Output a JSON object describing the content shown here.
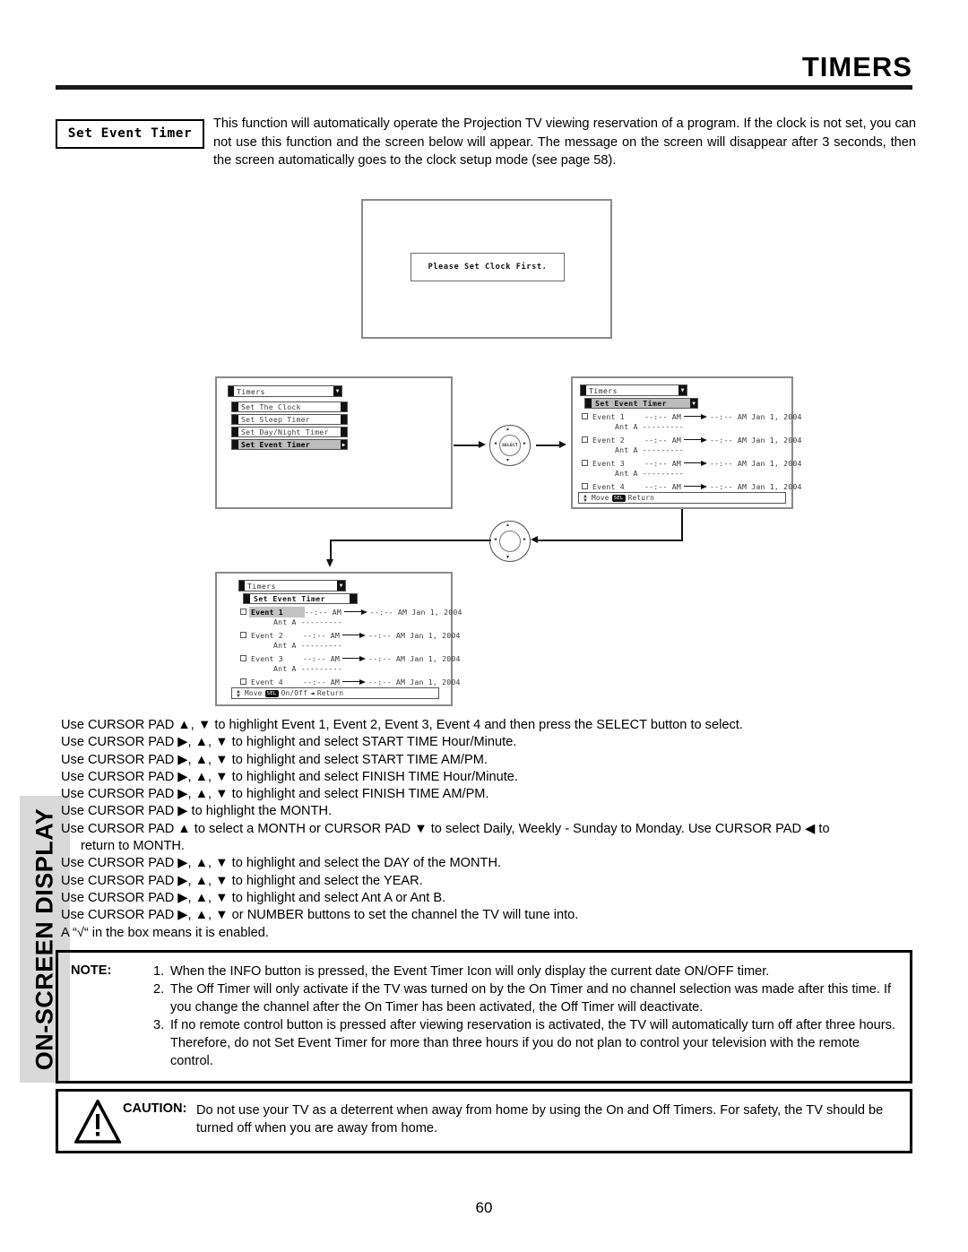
{
  "page": {
    "title": "TIMERS",
    "number": "60",
    "section_tab": "ON-SCREEN DISPLAY"
  },
  "intro": {
    "badge": "Set Event Timer",
    "text": "This function will automatically operate the Projection TV viewing reservation of a program.  If the clock is not set, you can not use this function and the screen below will appear.  The message on the screen will disappear after 3 seconds, then the screen automatically goes to the clock setup mode (see page 58)."
  },
  "screens": {
    "clock_warning": {
      "message": "Please Set Clock First."
    },
    "timers_menu": {
      "title": "Timers",
      "title_arrow": "▼",
      "items": [
        {
          "label": "Set The Clock",
          "selected": false,
          "right_glyph": ""
        },
        {
          "label": "Set Sleep Timer",
          "selected": false,
          "right_glyph": ""
        },
        {
          "label": "Set Day/Night Timer",
          "selected": false,
          "right_glyph": ""
        },
        {
          "label": "Set Event Timer",
          "selected": true,
          "right_glyph": "▶"
        }
      ]
    },
    "event_timer_right": {
      "title": "Timers",
      "title_arrow": "▼",
      "subtitle": "Set Event Timer",
      "subtitle_arrow": "▼",
      "highlight_row": -1,
      "rows": [
        {
          "name": "Event 1",
          "start": "--:-- AM",
          "finish": "--:-- AM",
          "date": "Jan 1, 2004",
          "ant": "Ant A ---------"
        },
        {
          "name": "Event 2",
          "start": "--:-- AM",
          "finish": "--:-- AM",
          "date": "Jan 1, 2004",
          "ant": "Ant A ---------"
        },
        {
          "name": "Event 3",
          "start": "--:-- AM",
          "finish": "--:-- AM",
          "date": "Jan 1, 2004",
          "ant": "Ant A ---------"
        },
        {
          "name": "Event 4",
          "start": "--:-- AM",
          "finish": "--:-- AM",
          "date": "Jan 1, 2004",
          "ant": "Ant A ---------"
        }
      ],
      "footer": {
        "move": "Move",
        "sel_key": "SEL",
        "action": "",
        "return": "Return"
      }
    },
    "event_timer_bottom": {
      "title": "Timers",
      "title_arrow": "▼",
      "subtitle": "Set Event Timer",
      "subtitle_arrow": "",
      "highlight_row": 0,
      "rows": [
        {
          "name": "Event 1",
          "start": "--:-- AM",
          "finish": "--:-- AM",
          "date": "Jan 1, 2004",
          "ant": "Ant A ---------"
        },
        {
          "name": "Event 2",
          "start": "--:-- AM",
          "finish": "--:-- AM",
          "date": "Jan 1, 2004",
          "ant": "Ant A ---------"
        },
        {
          "name": "Event 3",
          "start": "--:-- AM",
          "finish": "--:-- AM",
          "date": "Jan 1, 2004",
          "ant": "Ant A ---------"
        },
        {
          "name": "Event 4",
          "start": "--:-- AM",
          "finish": "--:-- AM",
          "date": "Jan 1, 2004",
          "ant": "Ant A ---------"
        }
      ],
      "footer": {
        "move": "Move",
        "sel_key": "SEL",
        "action": "On/Off",
        "return": "Return"
      }
    }
  },
  "cursor_pads": {
    "top": {
      "hub_label": "SELECT"
    },
    "bottom": {
      "hub_label": ""
    }
  },
  "instructions": [
    "Use CURSOR PAD ▲, ▼ to highlight Event 1, Event 2, Event 3, Event 4 and then press the SELECT button to select.",
    "Use CURSOR PAD ▶, ▲, ▼ to highlight and select START TIME Hour/Minute.",
    "Use CURSOR PAD ▶, ▲, ▼ to highlight and select START TIME AM/PM.",
    "Use CURSOR PAD ▶, ▲, ▼ to highlight and select FINISH TIME Hour/Minute.",
    "Use CURSOR PAD ▶, ▲, ▼ to highlight and select FINISH TIME AM/PM.",
    "Use CURSOR PAD ▶ to highlight the MONTH.",
    "Use CURSOR PAD ▲ to select a MONTH or CURSOR PAD ▼ to select Daily, Weekly - Sunday to Monday.  Use CURSOR PAD ◀ to",
    "return to MONTH.",
    "Use CURSOR PAD ▶, ▲, ▼ to highlight and select the DAY of the MONTH.",
    "Use CURSOR PAD ▶, ▲, ▼ to highlight and select the YEAR.",
    "Use CURSOR PAD ▶, ▲, ▼ to highlight and select Ant A or Ant B.",
    "Use CURSOR PAD ▶, ▲, ▼ or NUMBER buttons to set the channel the TV will tune into.",
    "A “√“ in the box means it is enabled."
  ],
  "note": {
    "label": "NOTE:",
    "items": [
      {
        "num": "1.",
        "text": "When the INFO button is pressed, the Event Timer Icon will only display the current date ON/OFF timer."
      },
      {
        "num": "2.",
        "text": "The Off Timer will only activate if the TV was turned on by the On Timer and no channel selection was made after this time.  If you change the channel after the On Timer has been activated, the Off Timer will deactivate."
      },
      {
        "num": "3.",
        "text": "If no remote control button is pressed after viewing reservation is activated, the TV will automatically turn off after three hours.  Therefore, do not Set Event Timer for more than three hours if you do not plan to control your television with the remote control."
      }
    ]
  },
  "caution": {
    "label": "CAUTION:",
    "text": "Do not use your TV as a deterrent when away from home by using the On and Off Timers.  For safety, the TV should be turned off when you are away from home."
  }
}
